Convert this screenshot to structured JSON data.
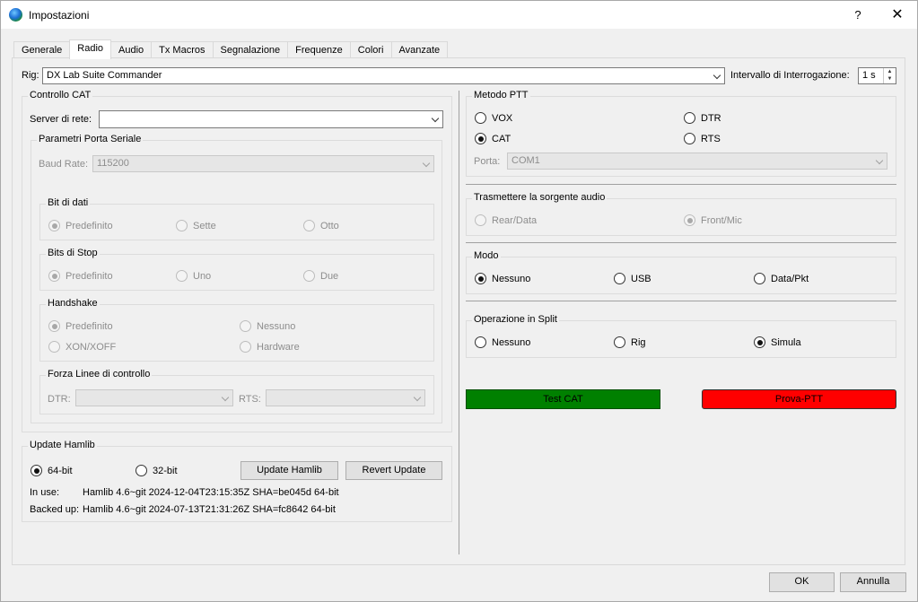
{
  "window": {
    "title": "Impostazioni",
    "help": "?",
    "close": "✕"
  },
  "tabs": [
    "Generale",
    "Radio",
    "Audio",
    "Tx Macros",
    "Segnalazione",
    "Frequenze",
    "Colori",
    "Avanzate"
  ],
  "rig": {
    "label": "Rig:",
    "value": "DX Lab Suite Commander",
    "poll_label": "Intervallo di Interrogazione:",
    "poll_value": "1 s"
  },
  "cat": {
    "title": "Controllo CAT",
    "server_label": "Server di rete:",
    "server_value": "",
    "serial": {
      "title": "Parametri Porta Seriale",
      "baud_label": "Baud Rate:",
      "baud_value": "115200",
      "data_bits": {
        "title": "Bit di dati",
        "options": [
          "Predefinito",
          "Sette",
          "Otto"
        ]
      },
      "stop_bits": {
        "title": "Bits di Stop",
        "options": [
          "Predefinito",
          "Uno",
          "Due"
        ]
      },
      "handshake": {
        "title": "Handshake",
        "options": [
          "Predefinito",
          "Nessuno",
          "XON/XOFF",
          "Hardware"
        ]
      },
      "force": {
        "title": "Forza Linee di controllo",
        "dtr_label": "DTR:",
        "rts_label": "RTS:"
      }
    }
  },
  "hamlib": {
    "title": "Update Hamlib",
    "opt_64": "64-bit",
    "opt_32": "32-bit",
    "update_button": "Update Hamlib",
    "revert_button": "Revert Update",
    "in_use_label": "In use:",
    "in_use_value": "Hamlib 4.6~git 2024-12-04T23:15:35Z SHA=be045d 64-bit",
    "backup_label": "Backed up:",
    "backup_value": "Hamlib 4.6~git 2024-07-13T21:31:26Z SHA=fc8642 64-bit"
  },
  "ptt": {
    "title": "Metodo PTT",
    "options": [
      "VOX",
      "DTR",
      "CAT",
      "RTS"
    ],
    "port_label": "Porta:",
    "port_value": "COM1"
  },
  "audio_source": {
    "title": "Trasmettere la sorgente audio",
    "options": [
      "Rear/Data",
      "Front/Mic"
    ]
  },
  "mode": {
    "title": "Modo",
    "options": [
      "Nessuno",
      "USB",
      "Data/Pkt"
    ]
  },
  "split": {
    "title": "Operazione in Split",
    "options": [
      "Nessuno",
      "Rig",
      "Simula"
    ]
  },
  "test_cat": "Test CAT",
  "test_ptt": "Prova-PTT",
  "colors": {
    "test_cat_bg": "#008000",
    "test_ptt_bg": "#ff0000"
  },
  "footer": {
    "ok": "OK",
    "cancel": "Annulla"
  }
}
